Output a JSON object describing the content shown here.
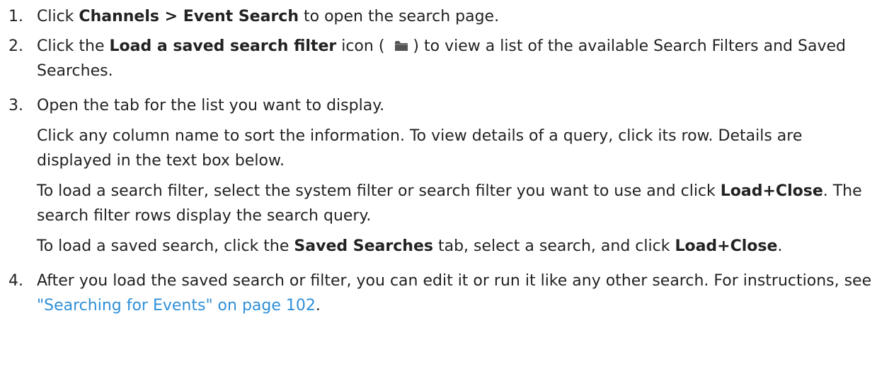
{
  "steps": [
    {
      "number": "1.",
      "parts": {
        "a": "Click ",
        "b": "Channels > Event Search",
        "c": " to open the search page."
      }
    },
    {
      "number": "2.",
      "parts": {
        "a": "Click the ",
        "b": "Load a saved search filter",
        "c": " icon (",
        "d": ") to view a list of the available Search Filters and Saved Searches."
      },
      "icon": "folder-icon"
    },
    {
      "number": "3.",
      "lead": "Open the tab for the list you want to display.",
      "para1": "Click any column name to sort the information. To view details of a query, click its row. Details are displayed in the text box below.",
      "para2": {
        "a": "To load a search filter, select the system filter or search filter you want to use and click ",
        "b": "Load+Close",
        "c": ". The search filter rows display the search query."
      },
      "para3": {
        "a": "To load a saved search, click the ",
        "b": "Saved Searches",
        "c": " tab, select a search, and click ",
        "d": "Load+Close",
        "e": "."
      }
    },
    {
      "number": "4.",
      "parts": {
        "a": "After you load the saved search or filter, you can edit it or run it like any other search. For instructions, see ",
        "link": "\"Searching for Events\" on page 102",
        "c": "."
      }
    }
  ],
  "colors": {
    "text": "#222222",
    "link": "#2f8fd8",
    "icon": "#555555"
  }
}
